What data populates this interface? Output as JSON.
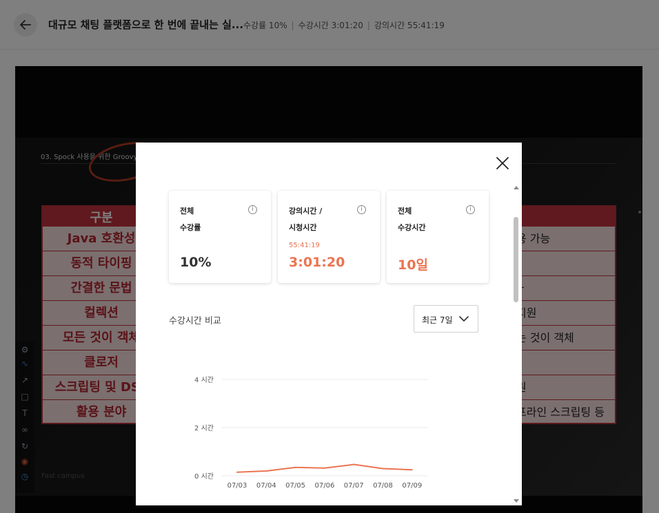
{
  "header": {
    "title": "대규모 채팅 플랫폼으로 한 번에 끝내는 실...",
    "progress_label": "수강률 10%",
    "watch_time_label": "수강시간 3:01:20",
    "lecture_time_label": "강의시간 55:41:19"
  },
  "slide": {
    "caption": "03. Spock 사용을 위한 Groovy",
    "header_label": "구분",
    "rows": [
      {
        "left": "Java 호환성",
        "right": "용 가능"
      },
      {
        "left": "동적 타이핑",
        "right": ""
      },
      {
        "left": "간결한 문법",
        "right": "ㅏ"
      },
      {
        "left": "컬렉션",
        "right": "지원"
      },
      {
        "left": "모든 것이 객체",
        "right": "는 것이 객체"
      },
      {
        "left": "클로저",
        "right": ""
      },
      {
        "left": "스크립팅 및 DSL",
        "right": "원"
      },
      {
        "left": "활용 분야",
        "right": "프라인 스크립팅 등"
      }
    ],
    "logo_text": "Fast campus"
  },
  "modal": {
    "cards": [
      {
        "line1": "전체",
        "line2": "수강률",
        "sub": "",
        "value": "10%",
        "accent": false
      },
      {
        "line1": "강의시간 /",
        "line2": "시청시간",
        "sub": "55:41:19",
        "value": "3:01:20",
        "accent": true
      },
      {
        "line1": "전체",
        "line2": "수강시간",
        "sub": "",
        "value": "10일",
        "accent": true
      }
    ],
    "info_symbol": "i",
    "chart_title": "수강시간 비교",
    "period_select": "최근 7일"
  },
  "colors": {
    "accent": "#eb7450",
    "slide_red": "#c1333d"
  },
  "chart_data": {
    "type": "line",
    "title": "수강시간 비교",
    "x": [
      "07/03",
      "07/04",
      "07/05",
      "07/06",
      "07/07",
      "07/08",
      "07/09"
    ],
    "series": [
      {
        "values": [
          0.15,
          0.2,
          0.35,
          0.32,
          0.47,
          0.3,
          0.25
        ]
      }
    ],
    "yticks": [
      {
        "value": 0,
        "label": "0 시간"
      },
      {
        "value": 2,
        "label": "2 시간"
      },
      {
        "value": 4,
        "label": "4 시간"
      }
    ],
    "ylim": [
      0,
      4
    ],
    "grid": true,
    "color": "#eb7450"
  }
}
